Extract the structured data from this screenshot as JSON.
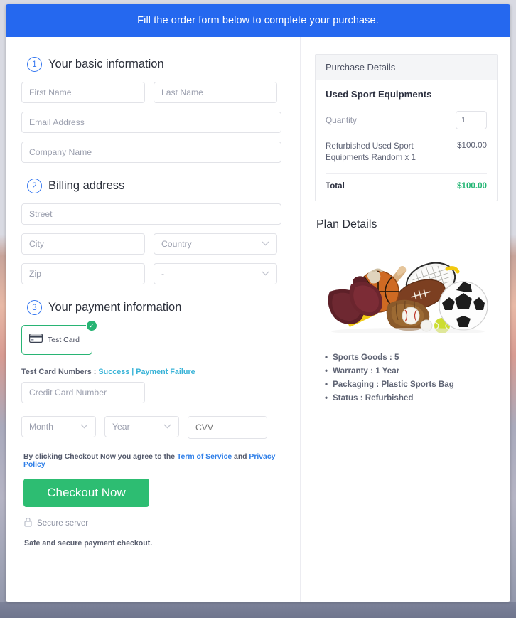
{
  "banner": {
    "message": "Fill the order form below to complete your purchase."
  },
  "form": {
    "sections": [
      {
        "number": "1",
        "title": "Your basic information"
      },
      {
        "number": "2",
        "title": "Billing address"
      },
      {
        "number": "3",
        "title": "Your payment information"
      }
    ],
    "basic": {
      "first_name_placeholder": "First Name",
      "first_name_value": "",
      "last_name_placeholder": "Last Name",
      "last_name_value": "",
      "email_placeholder": "Email Address",
      "email_value": "",
      "company_placeholder": "Company Name",
      "company_value": ""
    },
    "billing": {
      "street_placeholder": "Street",
      "street_value": "",
      "city_placeholder": "City",
      "city_value": "",
      "country_selected": "Country",
      "zip_placeholder": "Zip",
      "zip_value": "",
      "state_selected": "-"
    },
    "payment": {
      "card_tile_label": "Test Card",
      "tile_check_icon": "check-circle-icon",
      "card_brand_icon": "credit-card-icon",
      "test_card_prefix": "Test Card Numbers :",
      "test_card_success": "Success",
      "test_card_separator": "|",
      "test_card_failure": "Payment Failure",
      "card_number_placeholder": "Credit Card Number",
      "card_number_value": "",
      "month_selected": "Month",
      "year_selected": "Year",
      "cvv_placeholder": "CVV",
      "cvv_value": "",
      "cvv_icon": "credit-card-icon"
    },
    "footer": {
      "terms_prefix": "By clicking Checkout Now you agree to the",
      "terms_link": "Term of Service",
      "terms_and": "and",
      "privacy_link": "Privacy Policy",
      "checkout_label": "Checkout Now",
      "secure_icon": "lock-icon",
      "secure_label": "Secure server",
      "safe_note": "Safe and secure payment checkout."
    }
  },
  "sidebar": {
    "purchase": {
      "header": "Purchase Details",
      "product_title": "Used Sport Equipments",
      "quantity_label": "Quantity",
      "quantity_value": "1",
      "line_item_desc": "Refurbished Used Sport Equipments Random x 1",
      "line_item_amount": "$100.00",
      "total_label": "Total",
      "total_amount": "$100.00"
    },
    "plan": {
      "title": "Plan Details",
      "image_alt": "sports-equipment-photo",
      "features": [
        "Sports Goods : 5",
        "Warranty : 1 Year",
        "Packaging : Plastic Sports Bag",
        "Status : Refurbished"
      ]
    }
  },
  "colors": {
    "banner_blue": "#2568ef",
    "accent_green": "#2dbd72",
    "total_green": "#22b573",
    "step_blue": "#3577f0",
    "link_blue": "#2f7fe8",
    "link_teal": "#39b3d7"
  }
}
